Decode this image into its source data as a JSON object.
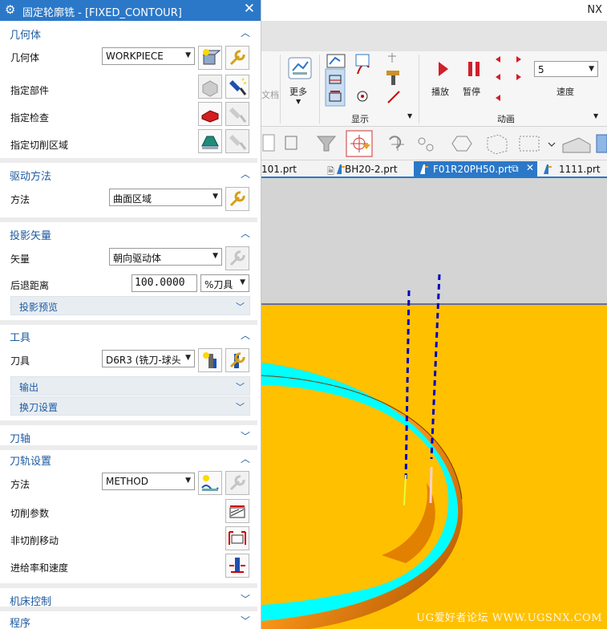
{
  "dialog": {
    "title": "固定轮廓铣 - [FIXED_CONTOUR]",
    "close": "✕",
    "sections": {
      "geometry": {
        "header": "几何体",
        "geometry_label": "几何体",
        "geometry_value": "WORKPIECE",
        "specify_part": "指定部件",
        "specify_check": "指定检查",
        "specify_cut_area": "指定切削区域"
      },
      "drive": {
        "header": "驱动方法",
        "method_label": "方法",
        "method_value": "曲面区域"
      },
      "projection": {
        "header": "投影矢量",
        "vector_label": "矢量",
        "vector_value": "朝向驱动体",
        "retreat_label": "后退距离",
        "retreat_value": "100.0000",
        "retreat_unit": "%刀具",
        "preview": "投影预览"
      },
      "tool": {
        "header": "工具",
        "tool_label": "刀具",
        "tool_value": "D6R3 (铣刀-球头",
        "output": "输出",
        "tool_change": "换刀设置"
      },
      "tool_axis": {
        "header": "刀轴"
      },
      "toolpath": {
        "header": "刀轨设置",
        "method_label": "方法",
        "method_value": "METHOD",
        "cut_params": "切削参数",
        "non_cut_moves": "非切削移动",
        "feeds_speeds": "进给率和速度"
      },
      "machine_control": {
        "header": "机床控制"
      },
      "program": {
        "header": "程序"
      }
    }
  },
  "app": {
    "name": "NX"
  },
  "ribbon": {
    "more_label": "更多",
    "display_label": "显示",
    "play_label": "播放",
    "pause_label": "暂停",
    "speed_label": "速度",
    "speed_value": "5",
    "animation_label": "动画",
    "partial_label": "文档"
  },
  "tabs": [
    "101.prt",
    "BH20-2.prt",
    "F01R20PH50.prt",
    "1111.prt"
  ],
  "watermark": "UG爱好者论坛 WWW.UGSNX.COM",
  "colors": {
    "accent": "#2b78c9",
    "viewport_bg": "#ffc000",
    "ring": "#ff8c00",
    "cyan": "#00ffff",
    "toolpath": "#0000c0"
  }
}
